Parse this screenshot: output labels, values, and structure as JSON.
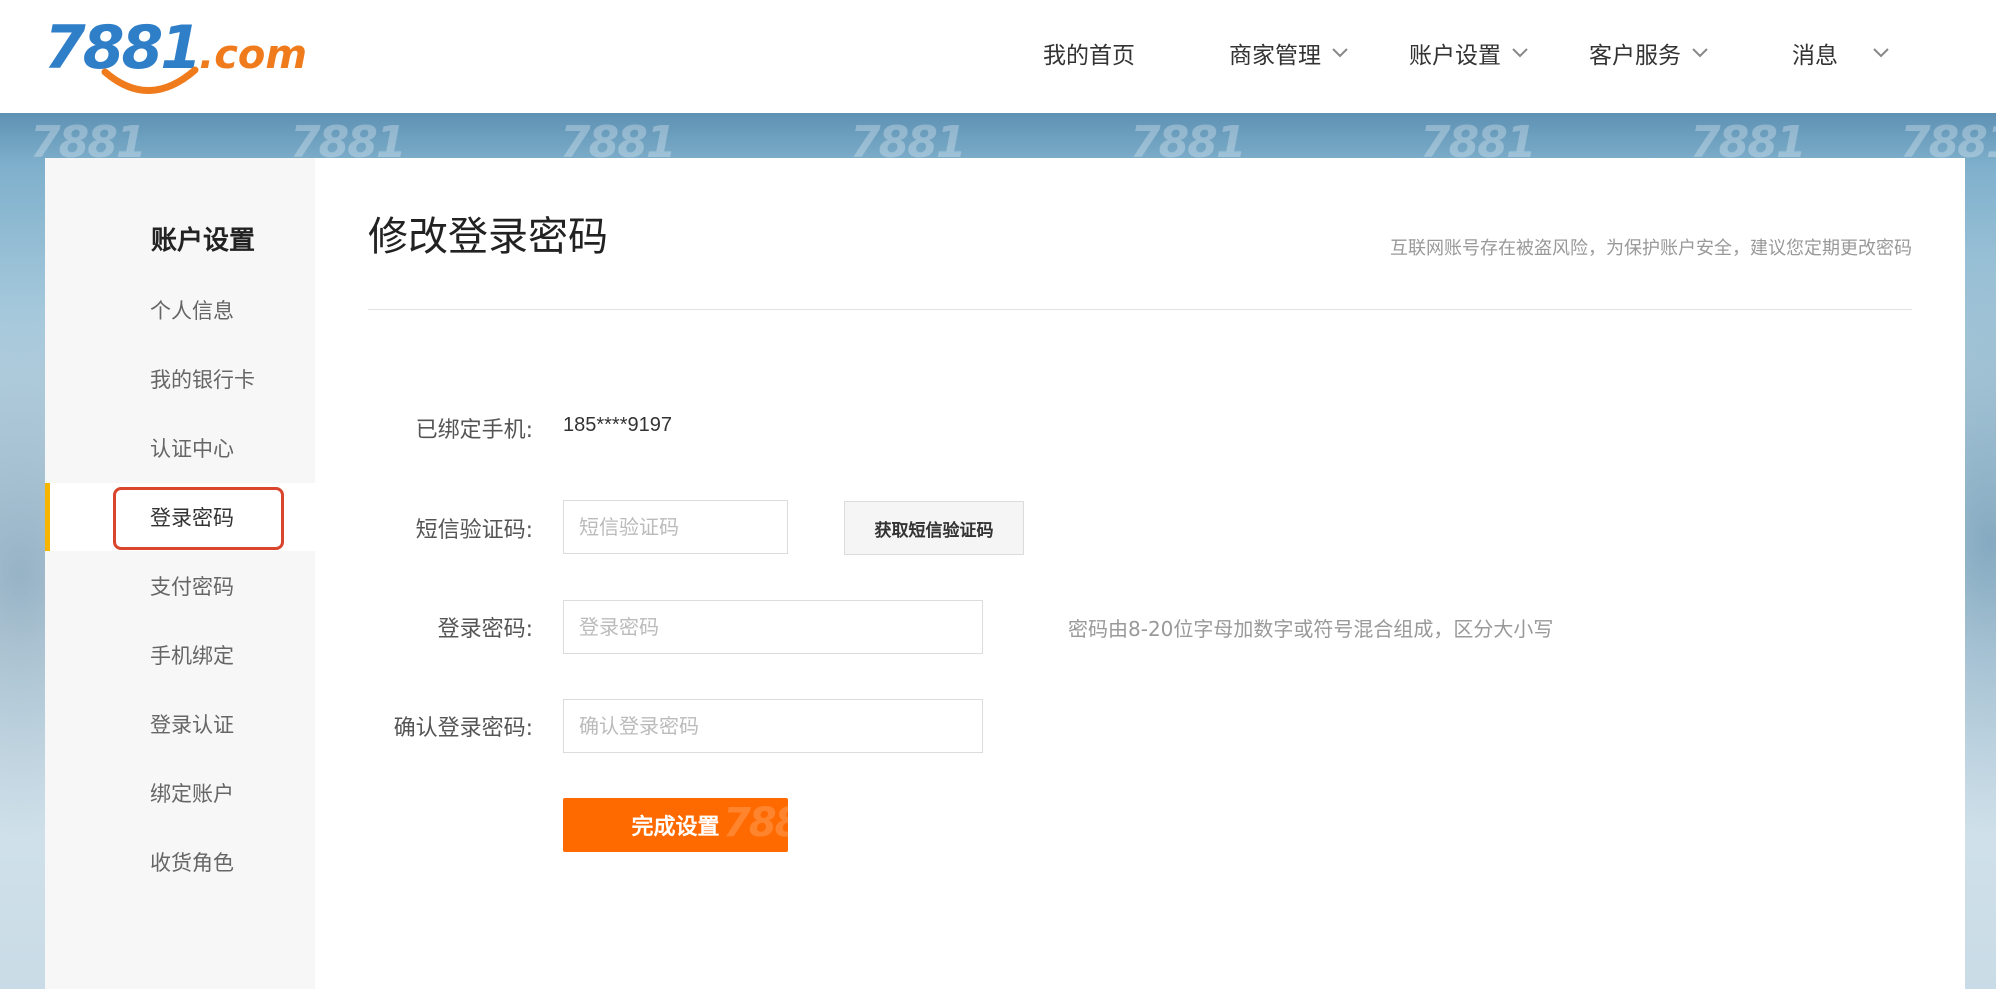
{
  "header": {
    "logo": {
      "digits": "7881",
      "domain": ".com"
    },
    "nav": [
      {
        "label": "我的首页",
        "has_dropdown": false
      },
      {
        "label": "商家管理",
        "has_dropdown": true
      },
      {
        "label": "账户设置",
        "has_dropdown": true
      },
      {
        "label": "客户服务",
        "has_dropdown": true
      },
      {
        "label": "消息",
        "has_dropdown": true
      }
    ]
  },
  "banner": {
    "watermark": "7881"
  },
  "sidebar": {
    "title": "账户设置",
    "active_index": 3,
    "items": [
      {
        "label": "个人信息"
      },
      {
        "label": "我的银行卡"
      },
      {
        "label": "认证中心"
      },
      {
        "label": "登录密码"
      },
      {
        "label": "支付密码"
      },
      {
        "label": "手机绑定"
      },
      {
        "label": "登录认证"
      },
      {
        "label": "绑定账户"
      },
      {
        "label": "收货角色"
      }
    ]
  },
  "main": {
    "title": "修改登录密码",
    "hint": "互联网账号存在被盗风险，为保护账户安全，建议您定期更改密码",
    "form": {
      "phone_label": "已绑定手机:",
      "phone_value": "185****9197",
      "sms_label": "短信验证码:",
      "sms_placeholder": "短信验证码",
      "sms_button": "获取短信验证码",
      "password_label": "登录密码:",
      "password_placeholder": "登录密码",
      "password_tip": "密码由8-20位字母加数字或符号混合组成，区分大小写",
      "confirm_label": "确认登录密码:",
      "confirm_placeholder": "确认登录密码",
      "submit_label": "完成设置"
    }
  },
  "colors": {
    "accent_orange": "#ff6a00",
    "logo_blue": "#2f7fc8",
    "active_bar": "#f7b500",
    "highlight_red": "#d9462d"
  }
}
